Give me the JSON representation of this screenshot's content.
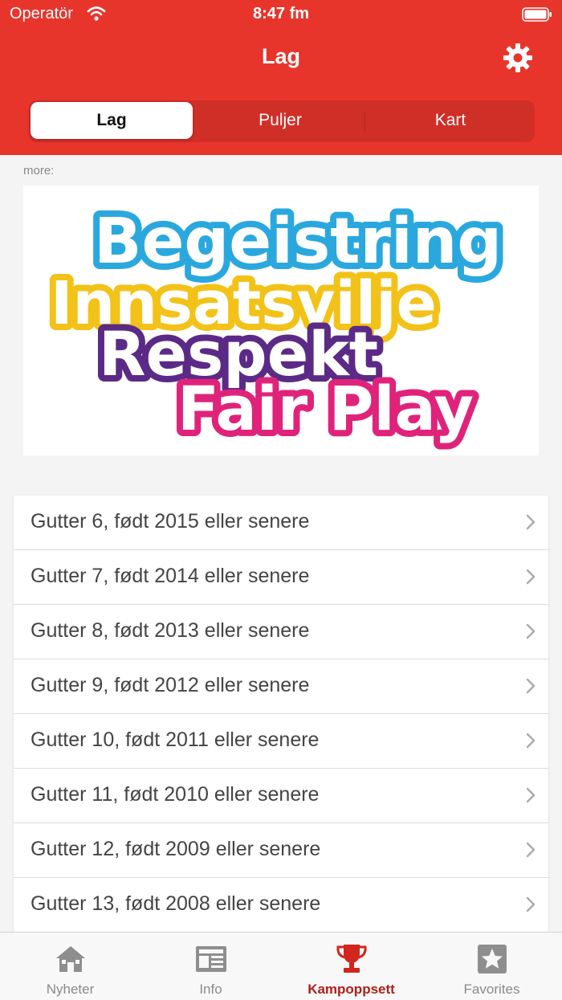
{
  "status_bar": {
    "carrier": "Operatör",
    "time": "8:47 fm"
  },
  "header": {
    "title": "Lag",
    "settings_icon": "gear-icon"
  },
  "segments": [
    {
      "label": "Lag",
      "active": true
    },
    {
      "label": "Puljer",
      "active": false
    },
    {
      "label": "Kart",
      "active": false
    }
  ],
  "more_label": "more:",
  "banner": {
    "lines": [
      "Begeistring",
      "Innsatsvilje",
      "Respekt",
      "Fair Play"
    ],
    "colors": [
      "#2aa8de",
      "#f2c218",
      "#5b2a86",
      "#e0237a"
    ]
  },
  "list": {
    "items": [
      "Gutter 6, født 2015 eller senere",
      "Gutter 7, født 2014 eller senere",
      "Gutter 8, født 2013 eller senere",
      "Gutter 9, født 2012 eller senere",
      "Gutter 10, født 2011 eller senere",
      "Gutter 11, født 2010 eller senere",
      "Gutter 12, født 2009 eller senere",
      "Gutter 13, født 2008 eller senere"
    ]
  },
  "tabbar": {
    "tabs": [
      {
        "label": "Nyheter",
        "icon": "house-icon"
      },
      {
        "label": "Info",
        "icon": "newspaper-icon"
      },
      {
        "label": "Kampoppsett",
        "icon": "trophy-icon",
        "active": true
      },
      {
        "label": "Favorites",
        "icon": "star-icon"
      }
    ]
  },
  "colors": {
    "brand_red": "#e8352c",
    "active_tab": "#b01f18"
  }
}
